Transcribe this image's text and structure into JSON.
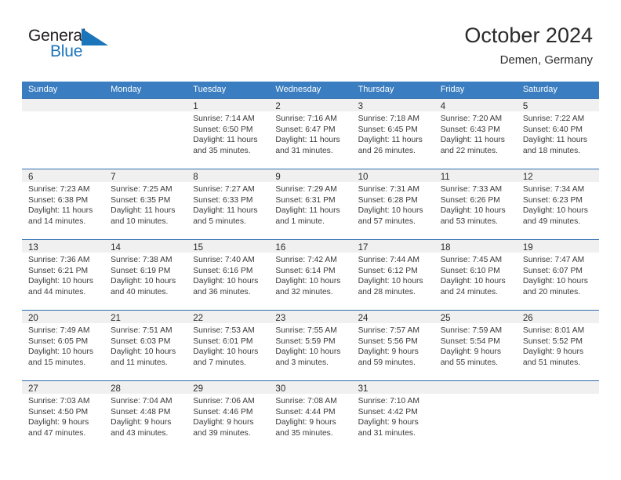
{
  "brand": {
    "word_one": "General",
    "word_two": "Blue",
    "flag_icon": "blue-flag-triangle",
    "color_dark": "#231f20",
    "color_blue": "#1b75bb"
  },
  "header": {
    "title": "October 2024",
    "subtitle": "Demen, Germany"
  },
  "theme": {
    "header_blue": "#3a7dc0",
    "row_border_blue": "#2e6daf",
    "day_band_gray": "#f0f0f0",
    "text_color": "#3a3a3a"
  },
  "weekdays": [
    "Sunday",
    "Monday",
    "Tuesday",
    "Wednesday",
    "Thursday",
    "Friday",
    "Saturday"
  ],
  "weeks": [
    [
      {
        "day": "",
        "sunrise": "",
        "sunset": "",
        "daylight": "",
        "empty": true
      },
      {
        "day": "",
        "sunrise": "",
        "sunset": "",
        "daylight": "",
        "empty": true
      },
      {
        "day": "1",
        "sunrise": "Sunrise: 7:14 AM",
        "sunset": "Sunset: 6:50 PM",
        "daylight": "Daylight: 11 hours and 35 minutes.",
        "empty": false
      },
      {
        "day": "2",
        "sunrise": "Sunrise: 7:16 AM",
        "sunset": "Sunset: 6:47 PM",
        "daylight": "Daylight: 11 hours and 31 minutes.",
        "empty": false
      },
      {
        "day": "3",
        "sunrise": "Sunrise: 7:18 AM",
        "sunset": "Sunset: 6:45 PM",
        "daylight": "Daylight: 11 hours and 26 minutes.",
        "empty": false
      },
      {
        "day": "4",
        "sunrise": "Sunrise: 7:20 AM",
        "sunset": "Sunset: 6:43 PM",
        "daylight": "Daylight: 11 hours and 22 minutes.",
        "empty": false
      },
      {
        "day": "5",
        "sunrise": "Sunrise: 7:22 AM",
        "sunset": "Sunset: 6:40 PM",
        "daylight": "Daylight: 11 hours and 18 minutes.",
        "empty": false
      }
    ],
    [
      {
        "day": "6",
        "sunrise": "Sunrise: 7:23 AM",
        "sunset": "Sunset: 6:38 PM",
        "daylight": "Daylight: 11 hours and 14 minutes.",
        "empty": false
      },
      {
        "day": "7",
        "sunrise": "Sunrise: 7:25 AM",
        "sunset": "Sunset: 6:35 PM",
        "daylight": "Daylight: 11 hours and 10 minutes.",
        "empty": false
      },
      {
        "day": "8",
        "sunrise": "Sunrise: 7:27 AM",
        "sunset": "Sunset: 6:33 PM",
        "daylight": "Daylight: 11 hours and 5 minutes.",
        "empty": false
      },
      {
        "day": "9",
        "sunrise": "Sunrise: 7:29 AM",
        "sunset": "Sunset: 6:31 PM",
        "daylight": "Daylight: 11 hours and 1 minute.",
        "empty": false
      },
      {
        "day": "10",
        "sunrise": "Sunrise: 7:31 AM",
        "sunset": "Sunset: 6:28 PM",
        "daylight": "Daylight: 10 hours and 57 minutes.",
        "empty": false
      },
      {
        "day": "11",
        "sunrise": "Sunrise: 7:33 AM",
        "sunset": "Sunset: 6:26 PM",
        "daylight": "Daylight: 10 hours and 53 minutes.",
        "empty": false
      },
      {
        "day": "12",
        "sunrise": "Sunrise: 7:34 AM",
        "sunset": "Sunset: 6:23 PM",
        "daylight": "Daylight: 10 hours and 49 minutes.",
        "empty": false
      }
    ],
    [
      {
        "day": "13",
        "sunrise": "Sunrise: 7:36 AM",
        "sunset": "Sunset: 6:21 PM",
        "daylight": "Daylight: 10 hours and 44 minutes.",
        "empty": false
      },
      {
        "day": "14",
        "sunrise": "Sunrise: 7:38 AM",
        "sunset": "Sunset: 6:19 PM",
        "daylight": "Daylight: 10 hours and 40 minutes.",
        "empty": false
      },
      {
        "day": "15",
        "sunrise": "Sunrise: 7:40 AM",
        "sunset": "Sunset: 6:16 PM",
        "daylight": "Daylight: 10 hours and 36 minutes.",
        "empty": false
      },
      {
        "day": "16",
        "sunrise": "Sunrise: 7:42 AM",
        "sunset": "Sunset: 6:14 PM",
        "daylight": "Daylight: 10 hours and 32 minutes.",
        "empty": false
      },
      {
        "day": "17",
        "sunrise": "Sunrise: 7:44 AM",
        "sunset": "Sunset: 6:12 PM",
        "daylight": "Daylight: 10 hours and 28 minutes.",
        "empty": false
      },
      {
        "day": "18",
        "sunrise": "Sunrise: 7:45 AM",
        "sunset": "Sunset: 6:10 PM",
        "daylight": "Daylight: 10 hours and 24 minutes.",
        "empty": false
      },
      {
        "day": "19",
        "sunrise": "Sunrise: 7:47 AM",
        "sunset": "Sunset: 6:07 PM",
        "daylight": "Daylight: 10 hours and 20 minutes.",
        "empty": false
      }
    ],
    [
      {
        "day": "20",
        "sunrise": "Sunrise: 7:49 AM",
        "sunset": "Sunset: 6:05 PM",
        "daylight": "Daylight: 10 hours and 15 minutes.",
        "empty": false
      },
      {
        "day": "21",
        "sunrise": "Sunrise: 7:51 AM",
        "sunset": "Sunset: 6:03 PM",
        "daylight": "Daylight: 10 hours and 11 minutes.",
        "empty": false
      },
      {
        "day": "22",
        "sunrise": "Sunrise: 7:53 AM",
        "sunset": "Sunset: 6:01 PM",
        "daylight": "Daylight: 10 hours and 7 minutes.",
        "empty": false
      },
      {
        "day": "23",
        "sunrise": "Sunrise: 7:55 AM",
        "sunset": "Sunset: 5:59 PM",
        "daylight": "Daylight: 10 hours and 3 minutes.",
        "empty": false
      },
      {
        "day": "24",
        "sunrise": "Sunrise: 7:57 AM",
        "sunset": "Sunset: 5:56 PM",
        "daylight": "Daylight: 9 hours and 59 minutes.",
        "empty": false
      },
      {
        "day": "25",
        "sunrise": "Sunrise: 7:59 AM",
        "sunset": "Sunset: 5:54 PM",
        "daylight": "Daylight: 9 hours and 55 minutes.",
        "empty": false
      },
      {
        "day": "26",
        "sunrise": "Sunrise: 8:01 AM",
        "sunset": "Sunset: 5:52 PM",
        "daylight": "Daylight: 9 hours and 51 minutes.",
        "empty": false
      }
    ],
    [
      {
        "day": "27",
        "sunrise": "Sunrise: 7:03 AM",
        "sunset": "Sunset: 4:50 PM",
        "daylight": "Daylight: 9 hours and 47 minutes.",
        "empty": false
      },
      {
        "day": "28",
        "sunrise": "Sunrise: 7:04 AM",
        "sunset": "Sunset: 4:48 PM",
        "daylight": "Daylight: 9 hours and 43 minutes.",
        "empty": false
      },
      {
        "day": "29",
        "sunrise": "Sunrise: 7:06 AM",
        "sunset": "Sunset: 4:46 PM",
        "daylight": "Daylight: 9 hours and 39 minutes.",
        "empty": false
      },
      {
        "day": "30",
        "sunrise": "Sunrise: 7:08 AM",
        "sunset": "Sunset: 4:44 PM",
        "daylight": "Daylight: 9 hours and 35 minutes.",
        "empty": false
      },
      {
        "day": "31",
        "sunrise": "Sunrise: 7:10 AM",
        "sunset": "Sunset: 4:42 PM",
        "daylight": "Daylight: 9 hours and 31 minutes.",
        "empty": false
      },
      {
        "day": "",
        "sunrise": "",
        "sunset": "",
        "daylight": "",
        "empty": true
      },
      {
        "day": "",
        "sunrise": "",
        "sunset": "",
        "daylight": "",
        "empty": true
      }
    ]
  ]
}
